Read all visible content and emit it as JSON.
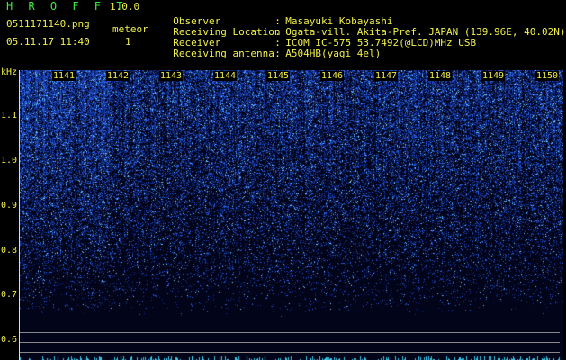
{
  "app": {
    "title": "H R O F F T",
    "version": "1.0.0"
  },
  "file_name": "0511171140.png",
  "datetime": "05.11.17 11:40",
  "meteor": {
    "label": "meteor",
    "count": "1"
  },
  "info": [
    {
      "key": "Observer",
      "value": "Masayuki Kobayashi"
    },
    {
      "key": "Receiving Location",
      "value": "Ogata-vill. Akita-Pref. JAPAN (139.96E, 40.02N)"
    },
    {
      "key": "Receiver",
      "value": "ICOM IC-575 53.7492(@LCD)MHz USB"
    },
    {
      "key": "Receiving antenna",
      "value": "A504HB(yagi 4el)"
    }
  ],
  "y_axis": {
    "unit": "kHz",
    "ticks": [
      "1.1",
      "1.0",
      "0.9",
      "0.8",
      "0.7",
      "0.6"
    ]
  },
  "minute_labels": [
    "1141",
    "1142",
    "1143",
    "1144",
    "1145",
    "1146",
    "1147",
    "1148",
    "1149",
    "1150"
  ],
  "colors": {
    "text_yellow": "#f0f04a",
    "text_green": "#3fe83f",
    "spectrum_low": "#02041a",
    "spectrum_high": "#4aa0ff"
  }
}
